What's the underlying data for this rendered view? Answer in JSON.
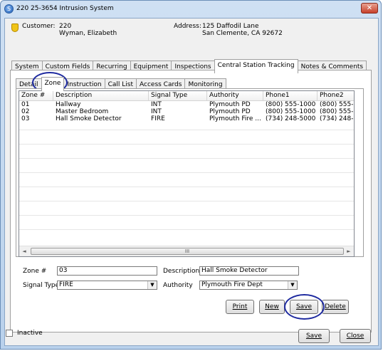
{
  "window": {
    "title": "220 25-3654 Intrusion System",
    "close_glyph": "✕"
  },
  "header": {
    "customer_label": "Customer:",
    "customer_number": "220",
    "customer_name": "Wyman, Elizabeth",
    "address_label": "Address:",
    "address_line1": "125 Daffodil Lane",
    "address_line2": "San Clemente, CA  92672"
  },
  "main_tabs": [
    "System",
    "Custom Fields",
    "Recurring",
    "Equipment",
    "Inspections",
    "Central Station Tracking",
    "Notes & Comments"
  ],
  "main_tabs_active": "Central Station Tracking",
  "sub_tabs": [
    "Detail",
    "Zone",
    "Instruction",
    "Call List",
    "Access Cards",
    "Monitoring"
  ],
  "sub_tabs_active": "Zone",
  "grid": {
    "columns": [
      "Zone #",
      "Description",
      "Signal Type",
      "Authority",
      "Phone1",
      "Phone2"
    ],
    "rows": [
      [
        "01",
        "Hallway",
        "INT",
        "Plymouth PD",
        "(800) 555-1000",
        "(800) 555-1:"
      ],
      [
        "02",
        "Master Bedroom",
        "INT",
        "Plymouth PD",
        "(800) 555-1000",
        "(800) 555-1:"
      ],
      [
        "03",
        "Hall Smoke Detector",
        "FIRE",
        "Plymouth Fire ...",
        "(734) 248-5000",
        "(734) 248-5:"
      ]
    ],
    "scroll_left": "◄",
    "scroll_right": "►",
    "scroll_grip": "III"
  },
  "form": {
    "zone_label": "Zone #",
    "zone_value": "03",
    "description_label": "Description",
    "description_value": "Hall Smoke Detector",
    "signal_type_label": "Signal Type",
    "signal_type_value": "FIRE",
    "authority_label": "Authority",
    "authority_value": "Plymouth Fire Dept",
    "dropdown_glyph": "▼"
  },
  "buttons": {
    "print": "Print",
    "new": "New",
    "save": "Save",
    "delete": "Delete",
    "bottom_save": "Save",
    "close": "Close"
  },
  "footer": {
    "inactive_label": "Inactive"
  }
}
